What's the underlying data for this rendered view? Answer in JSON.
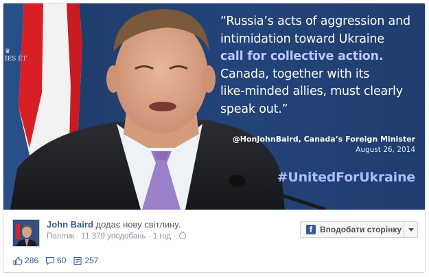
{
  "photo": {
    "quote_lines": [
      "“Russia’s acts of aggression and",
      "intimidation toward Ukraine",
      "call for collective action.",
      "Canada, together with its",
      "like-minded allies, must clearly",
      "speak out.”"
    ],
    "attribution_name": "@HonJohnBaird, Canada’s Foreign Minister",
    "attribution_date": "August 26, 2014",
    "hashtag": "#UnitedForUkraine",
    "logo_text": "IES ÉT"
  },
  "post": {
    "author": "John Baird",
    "action": "додає нову світлину.",
    "category": "Політик",
    "likes_count_text": "11 379 уподобань",
    "time": "1 год",
    "like_page_label": "Вподобати сторінку",
    "fb_logo": "f"
  },
  "stats": {
    "likes": "286",
    "comments": "60",
    "shares": "257"
  },
  "colors": {
    "link": "#3b5998",
    "photo_bg": "#203d6e",
    "highlight": "#b8c8ff",
    "hashtag": "#a9bcff"
  }
}
